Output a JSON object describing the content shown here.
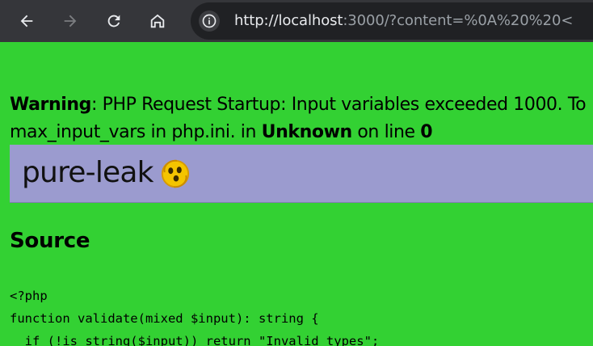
{
  "browser": {
    "url_host": "http://localhost",
    "url_rest": ":3000/?content=%0A%20%20<"
  },
  "warning": {
    "label": "Warning",
    "text1": ": PHP Request Startup: Input variables exceeded 1000. To",
    "text2": "max_input_vars in php.ini. in ",
    "location": "Unknown",
    "text3": " on line ",
    "line": "0"
  },
  "banner": {
    "title": "pure-leak",
    "icon": "dizzy-face-emoji"
  },
  "source": {
    "heading": "Source",
    "lines": [
      "<?php",
      "function validate(mixed $input): string {",
      "  if (!is_string($input)) return \"Invalid types\";"
    ]
  },
  "colors": {
    "page_bg": "#33d133",
    "banner_bg": "#9b9bcf",
    "browser_bar": "#35363a"
  }
}
